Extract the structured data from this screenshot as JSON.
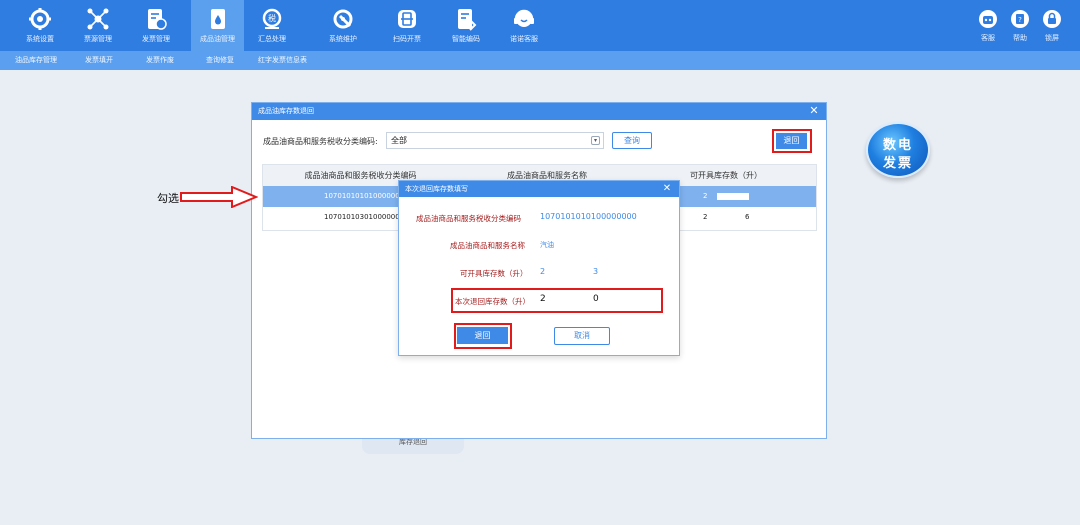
{
  "nav": {
    "items": [
      {
        "label": "系统设置",
        "icon": "gear-icon"
      },
      {
        "label": "票源管理",
        "icon": "network-icon"
      },
      {
        "label": "发票管理",
        "icon": "invoice-icon"
      },
      {
        "label": "成品油管理",
        "icon": "oil-drop-icon"
      },
      {
        "label": "汇总处理",
        "icon": "tax-icon"
      },
      {
        "label": "系统维护",
        "icon": "maintenance-icon"
      },
      {
        "label": "扫码开票",
        "icon": "scan-icon"
      },
      {
        "label": "智能编码",
        "icon": "smart-code-icon"
      },
      {
        "label": "诺诺客服",
        "icon": "headset-icon"
      }
    ],
    "active": "成品油管理",
    "utils": [
      {
        "label": "客服",
        "icon": "robot-icon"
      },
      {
        "label": "帮助",
        "icon": "help-book-icon"
      },
      {
        "label": "锁屏",
        "icon": "lock-icon"
      }
    ]
  },
  "subnav": [
    "油品库存管理",
    "发票填开",
    "发票作废",
    "查询修复",
    "红字发票信息表"
  ],
  "main_dialog": {
    "title": "成品油库存数退回",
    "filter_label": "成品油商品和服务税收分类编码:",
    "filter_value": "全部",
    "query_label": "查询",
    "return_label": "退回",
    "columns": [
      "成品油商品和服务税收分类编码",
      "成品油商品和服务名称",
      "可开具库存数（升）"
    ],
    "rows": [
      {
        "code": "10701010101000000000",
        "stock": "2"
      },
      {
        "code": "10701010301000000000",
        "stock": "2",
        "stock_extra": "6"
      }
    ]
  },
  "annotation": {
    "label": "勾选"
  },
  "badge": {
    "line1": "数电",
    "line2": "发票"
  },
  "background_tab": {
    "label": "库存退回"
  },
  "inner_dialog": {
    "title": "本次退回库存数填写",
    "code_label": "成品油商品和服务税收分类编码",
    "code_value": "1070101010100000000",
    "name_label": "成品油商品和服务名称",
    "name_value": "汽油",
    "stock_label": "可开具库存数（升）",
    "stock_value": "2",
    "stock_value2": "3",
    "return_qty_label": "本次退回库存数（升）",
    "return_qty_value": "2",
    "return_qty_value2": "0",
    "return_label": "退回",
    "cancel_label": "取消"
  },
  "colors": {
    "primary": "#2f7de1",
    "accent": "#3f8ae6",
    "highlight": "#e11b1b",
    "label_red": "#a51d1d"
  }
}
